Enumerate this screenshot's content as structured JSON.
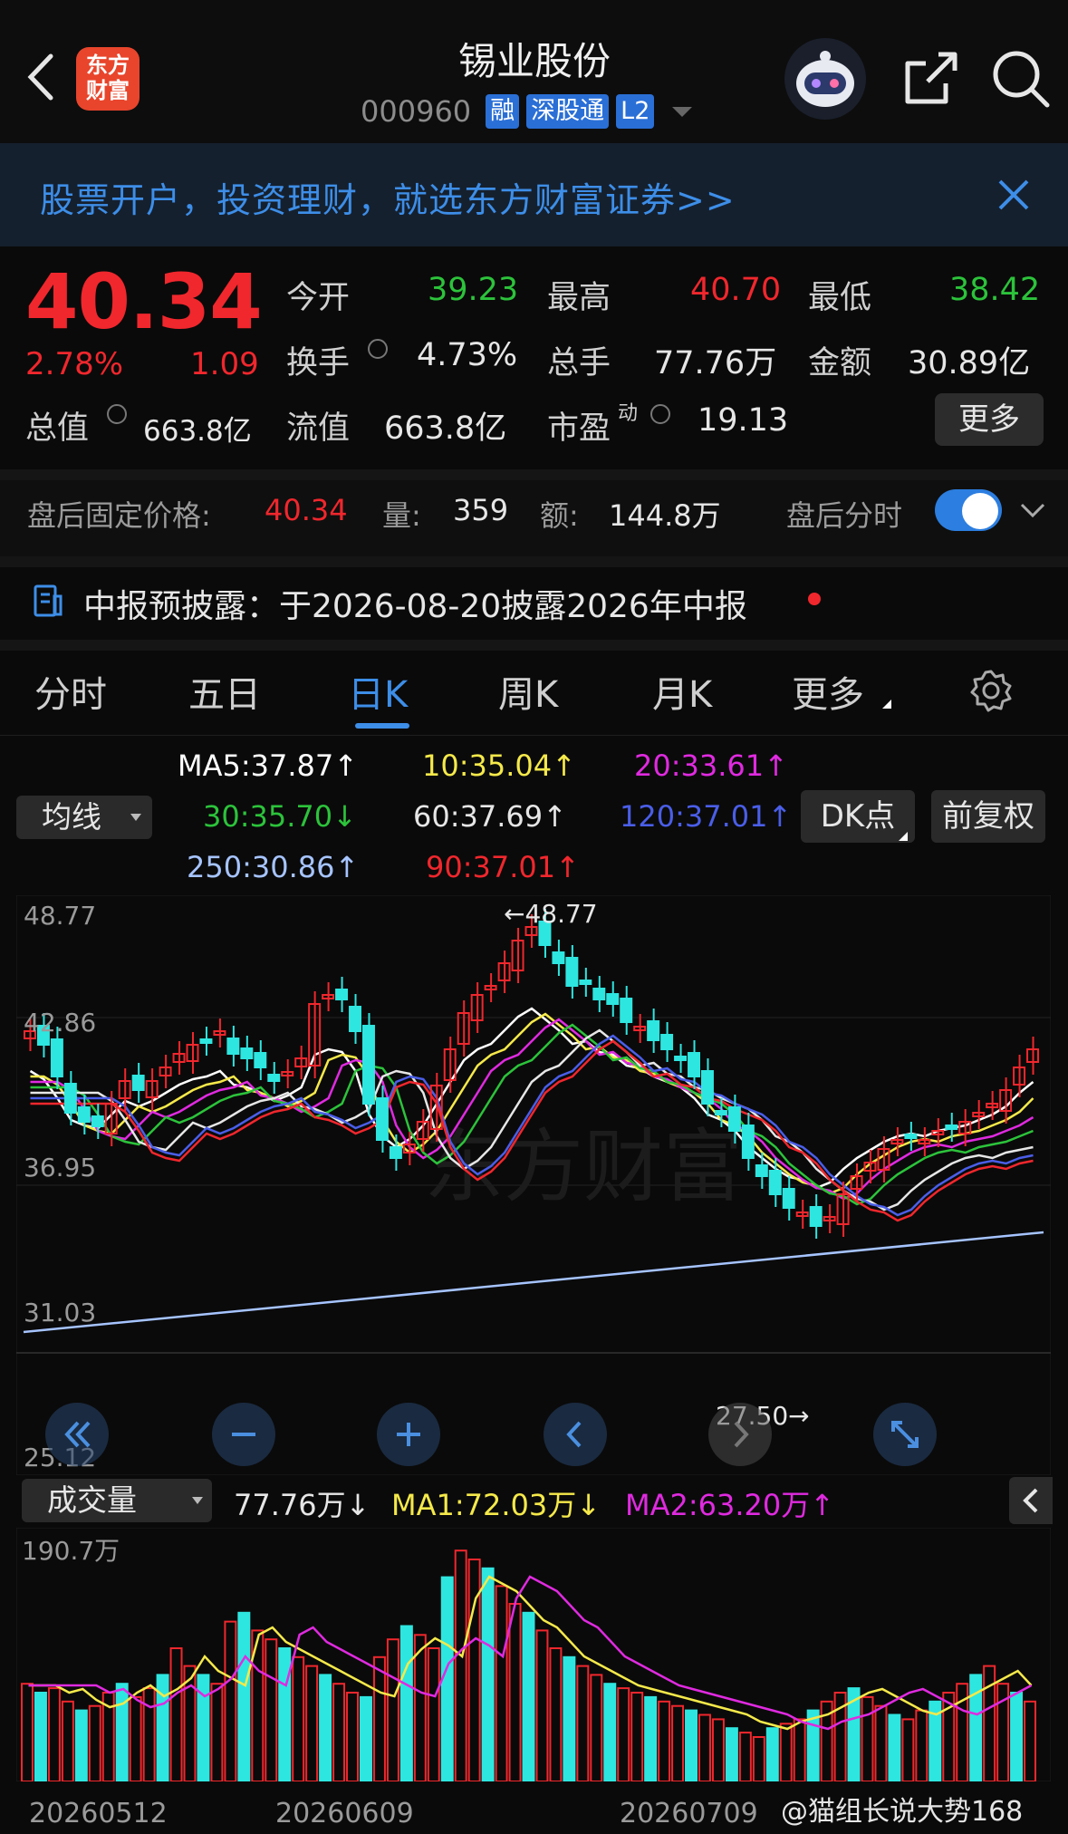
{
  "header": {
    "logo_text": "东方财富",
    "title": "锡业股份",
    "code": "000960",
    "tags": [
      "融",
      "深股通",
      "L2"
    ]
  },
  "banner": {
    "text": "股票开户，投资理财，就选东方财富证券>>"
  },
  "quote": {
    "price": "40.34",
    "pct": "2.78%",
    "change": "1.09",
    "open_label": "今开",
    "open": "39.23",
    "high_label": "最高",
    "high": "40.70",
    "low_label": "最低",
    "low": "38.42",
    "turnover_label": "换手",
    "turnover": "4.73%",
    "volume_label": "总手",
    "volume": "77.76万",
    "amount_label": "金额",
    "amount": "30.89亿",
    "mktcap_label": "总值",
    "mktcap": "663.8亿",
    "float_label": "流值",
    "float": "663.8亿",
    "pe_label": "市盈",
    "pe_sup": "动",
    "pe": "19.13",
    "more": "更多"
  },
  "after_hours": {
    "label": "盘后固定价格:",
    "price": "40.34",
    "vol_label": "量:",
    "vol": "359",
    "amt_label": "额:",
    "amt": "144.8万",
    "toggle_label": "盘后分时"
  },
  "notice": {
    "text": "中报预披露：于2026-08-20披露2026年中报"
  },
  "tabs": [
    "分时",
    "五日",
    "日K",
    "周K",
    "月K",
    "更多"
  ],
  "ma_legend": {
    "ma5": "MA5:37.87↑",
    "ma10": "10:35.04↑",
    "ma20": "20:33.61↑",
    "ma30": "30:35.70↓",
    "ma60": "60:37.69↑",
    "ma120": "120:37.01↑",
    "ma250": "250:30.86↑",
    "ma90": "90:37.01↑"
  },
  "buttons": {
    "indicator": "均线",
    "dk": "DK点",
    "adjust": "前复权"
  },
  "price_chart": {
    "y_ticks": [
      "48.77",
      "42.86",
      "36.95",
      "31.03",
      "25.12"
    ],
    "max_label": "←48.77",
    "min_label": "27.50→"
  },
  "volume_bar": {
    "selector": "成交量",
    "vol": "77.76万↓",
    "ma1": "MA1:72.03万↓",
    "ma2": "MA2:63.20万↑",
    "max_label": "190.7万"
  },
  "dates": [
    "20260512",
    "20260609",
    "20260709"
  ],
  "watermark": "@猫组长说大势168",
  "colors": {
    "up": "#f0272d",
    "down": "#2ee6e0",
    "accent": "#3d8ee8",
    "ma5": "#ffffff",
    "ma10": "#f5e94a",
    "ma20": "#e02ae0",
    "ma30": "#2cc33b",
    "ma250": "#a6c4ff"
  }
}
